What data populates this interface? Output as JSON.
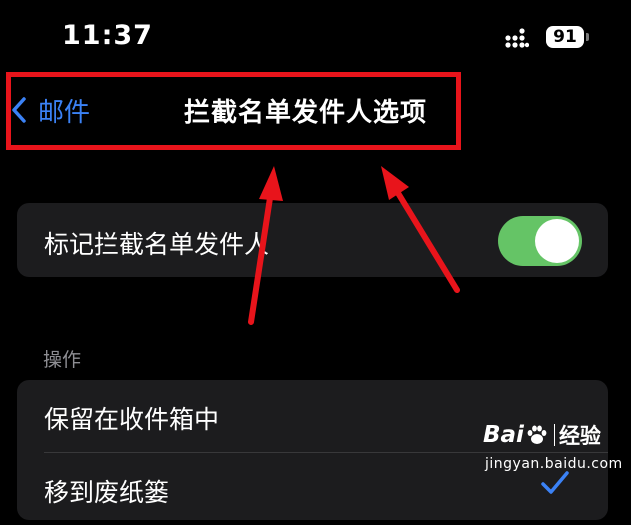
{
  "status_bar": {
    "time": "11:37",
    "battery": "91",
    "icons": [
      "signal-icon",
      "battery-icon"
    ]
  },
  "nav": {
    "back_label": "邮件",
    "title": "拦截名单发件人选项",
    "back_icon": "chevron-left-icon"
  },
  "flag_row": {
    "label": "标记拦截名单发件人",
    "toggle_on": true
  },
  "actions": {
    "header": "操作",
    "items": [
      {
        "label": "保留在收件箱中",
        "checked": false
      },
      {
        "label": "移到废纸篓",
        "checked": true
      }
    ]
  },
  "watermark": {
    "brand_left": "Bai",
    "brand_right": "经验",
    "url": "jingyan.baidu.com"
  },
  "colors": {
    "background": "#000000",
    "group_bg": "#1c1c1e",
    "accent_blue": "#3b82f6",
    "toggle_green": "#65c466",
    "annotation_red": "#e8141b",
    "section_gray": "#8e8e93"
  }
}
